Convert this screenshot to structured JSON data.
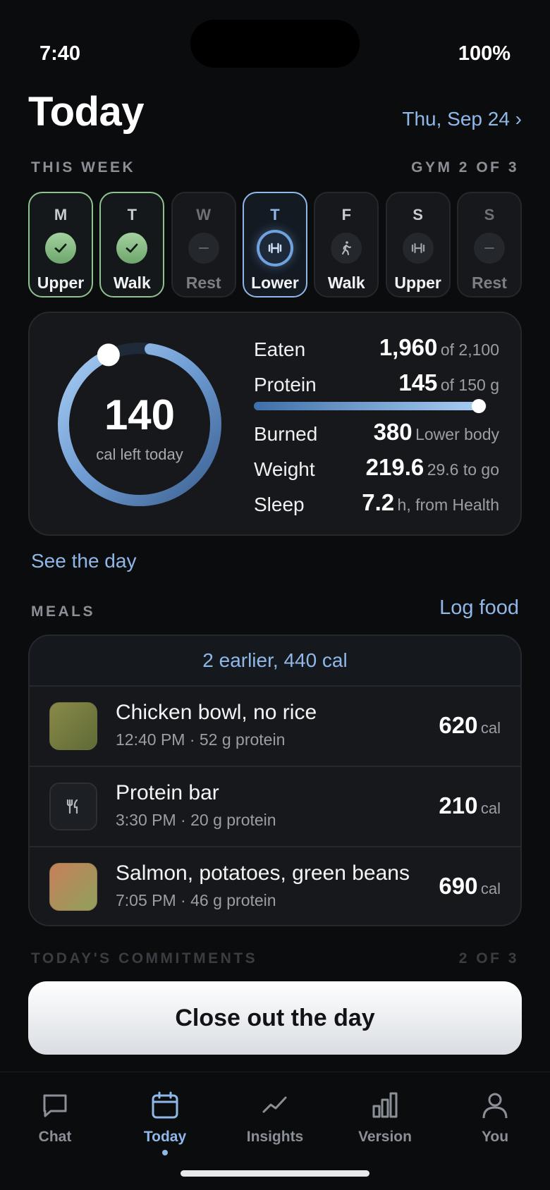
{
  "status": {
    "time": "7:40",
    "battery": "100%"
  },
  "header": {
    "title": "Today",
    "date": "Thu, Sep 24 ›"
  },
  "week": {
    "label": "THIS WEEK",
    "progress": "GYM 2 OF 3",
    "days": [
      {
        "letter": "M",
        "name": "Upper",
        "state": "done",
        "icon": "check-icon"
      },
      {
        "letter": "T",
        "name": "Walk",
        "state": "done",
        "icon": "check-icon"
      },
      {
        "letter": "W",
        "name": "Rest",
        "state": "rest",
        "icon": "dash-icon"
      },
      {
        "letter": "T",
        "name": "Lower",
        "state": "current",
        "icon": "dumbbell-icon"
      },
      {
        "letter": "F",
        "name": "Walk",
        "state": "planned",
        "icon": "walk-icon"
      },
      {
        "letter": "S",
        "name": "Upper",
        "state": "planned",
        "icon": "dumbbell-icon"
      },
      {
        "letter": "S",
        "name": "Rest",
        "state": "rest",
        "icon": "dash-icon"
      }
    ]
  },
  "summary": {
    "cal_left": "140",
    "cal_left_label": "cal left today",
    "ring_fraction": 0.933,
    "eaten": {
      "label": "Eaten",
      "value": "1,960",
      "unit": "of 2,100"
    },
    "protein": {
      "label": "Protein",
      "value": "145",
      "unit": "of 150 g",
      "fraction": 0.967
    },
    "burned": {
      "label": "Burned",
      "value": "380",
      "unit": "Lower body"
    },
    "weight": {
      "label": "Weight",
      "value": "219.6",
      "unit": "29.6 to go"
    },
    "sleep": {
      "label": "Sleep",
      "value": "7.2",
      "unit": "h, from Health"
    },
    "see_day": "See the day"
  },
  "meals": {
    "label": "MEALS",
    "log_food": "Log food",
    "earlier": "2 earlier, 440 cal",
    "items": [
      {
        "title": "Chicken bowl, no rice",
        "meta": "12:40 PM · 52 g protein",
        "cal": "620",
        "unit": "cal",
        "thumb": "photo"
      },
      {
        "title": "Protein bar",
        "meta": "3:30 PM · 20 g protein",
        "cal": "210",
        "unit": "cal",
        "thumb": "fork-knife-icon"
      },
      {
        "title": "Salmon, potatoes, green beans",
        "meta": "7:05 PM · 46 g protein",
        "cal": "690",
        "unit": "cal",
        "thumb": "photo"
      }
    ]
  },
  "commitments": {
    "label": "TODAY'S COMMITMENTS",
    "progress": "2 OF 3"
  },
  "close_out": "Close out the day",
  "tabs": [
    {
      "label": "Chat",
      "icon": "chat-bubble-icon"
    },
    {
      "label": "Today",
      "icon": "calendar-icon",
      "active": true
    },
    {
      "label": "Insights",
      "icon": "trend-line-icon"
    },
    {
      "label": "Version",
      "icon": "bar-chart-icon"
    },
    {
      "label": "You",
      "icon": "person-icon"
    }
  ],
  "colors": {
    "accent": "#8fb8e8",
    "done": "#8fc291",
    "background": "#0b0c0e",
    "card": "#16181b"
  }
}
